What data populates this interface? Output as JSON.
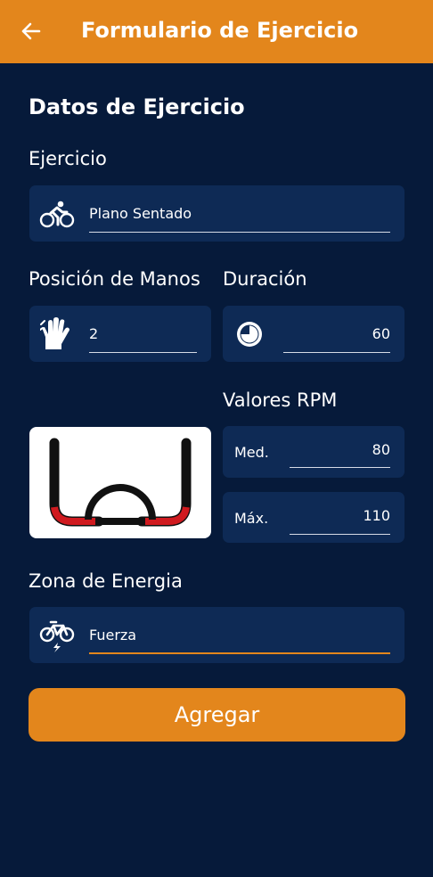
{
  "appbar": {
    "title": "Formulario de Ejercicio",
    "back_icon": "arrow-left-icon",
    "color": "#e3861c"
  },
  "section": {
    "title": "Datos de Ejercicio"
  },
  "ejercicio": {
    "label": "Ejercicio",
    "value": "Plano Sentado",
    "icon": "cyclist-icon"
  },
  "posicion": {
    "label": "Posición de Manos",
    "value": "2",
    "icon": "hand-icon"
  },
  "duracion": {
    "label": "Duración",
    "value": "60",
    "icon": "timer-icon"
  },
  "rpm": {
    "label": "Valores RPM",
    "med_label": "Med.",
    "med_value": "80",
    "max_label": "Máx.",
    "max_value": "110"
  },
  "handlebar_image": {
    "icon": "handlebar-image"
  },
  "zona": {
    "label": "Zona de Energia",
    "value": "Fuerza",
    "icon": "ebike-icon"
  },
  "add_button": {
    "label": "Agregar"
  },
  "colors": {
    "background": "#061a3a",
    "card": "#0e2a55",
    "accent": "#e3861c"
  }
}
